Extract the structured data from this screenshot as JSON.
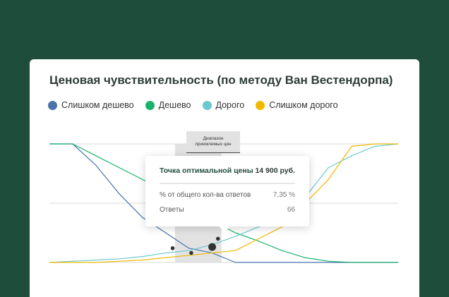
{
  "title": "Ценовая чувствительность (по методу Ван Вестендорпа)",
  "legend": [
    {
      "label": "Слишком дешево",
      "color": "#4a72ad"
    },
    {
      "label": "Дешево",
      "color": "#1ab36c"
    },
    {
      "label": "Дорого",
      "color": "#6cc9cf"
    },
    {
      "label": "Слишком дорого",
      "color": "#f0b800"
    }
  ],
  "range_label": {
    "line1": "Диапазон",
    "line2": "приемлемых цен"
  },
  "tooltip": {
    "title": "Точка оптимальной цены",
    "title_value": "14 900 руб.",
    "rows": [
      {
        "label": "% от общего кол-ва ответов",
        "value": "7,35 %"
      },
      {
        "label": "Ответы",
        "value": "66"
      }
    ]
  },
  "colors": {
    "background": "#1f4d3c",
    "card": "#ffffff",
    "grid": "#d9d9d9",
    "range_band": "#e2e2e2",
    "intersection": "#333333"
  },
  "chart_data": {
    "type": "line",
    "x": [
      0,
      1,
      2,
      3,
      4,
      5,
      6,
      7,
      8,
      9,
      10,
      11,
      12,
      13,
      14,
      15
    ],
    "ylim": [
      0,
      100
    ],
    "grid": true,
    "series": [
      {
        "name": "Слишком дешево",
        "color": "#4a72ad",
        "values": [
          100,
          100,
          82,
          58,
          38,
          25,
          12,
          8,
          0,
          0,
          0,
          0,
          0,
          0,
          0,
          0
        ]
      },
      {
        "name": "Дешево",
        "color": "#1ab36c",
        "values": [
          100,
          100,
          90,
          80,
          70,
          60,
          45,
          35,
          25,
          18,
          10,
          4,
          1,
          0,
          0,
          0
        ]
      },
      {
        "name": "Дорого",
        "color": "#6cc9cf",
        "values": [
          0,
          1,
          2,
          3,
          5,
          8,
          10,
          15,
          22,
          30,
          40,
          55,
          80,
          90,
          98,
          100
        ]
      },
      {
        "name": "Слишком дорого",
        "color": "#f0b800",
        "values": [
          0,
          0,
          0,
          1,
          2,
          4,
          6,
          8,
          10,
          20,
          30,
          50,
          70,
          98,
          100,
          100
        ]
      }
    ],
    "range_start": 5.4,
    "range_end": 7.4,
    "intersections": [
      {
        "x": 5.3,
        "y": 12
      },
      {
        "x": 6.1,
        "y": 8
      },
      {
        "x": 7.25,
        "y": 20
      },
      {
        "x": 7.0,
        "y": 13,
        "highlight": true
      }
    ]
  }
}
